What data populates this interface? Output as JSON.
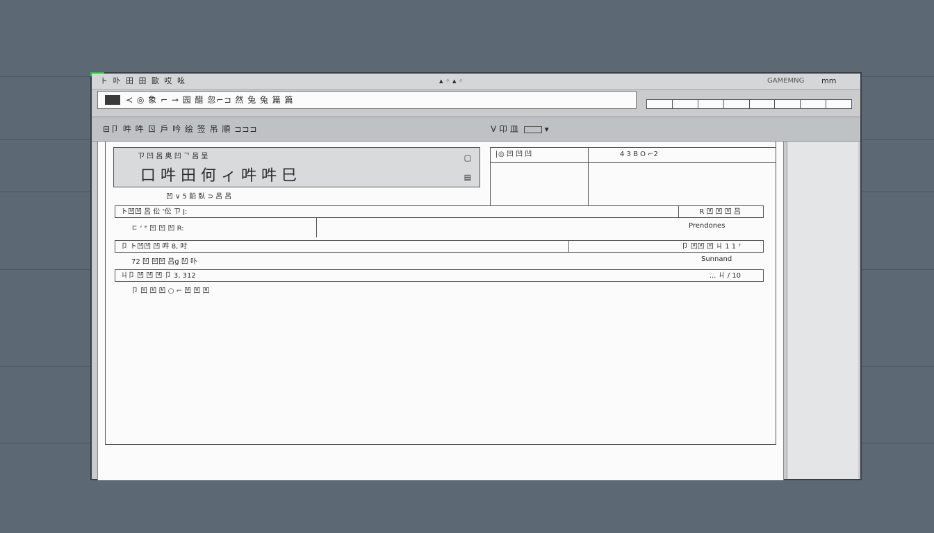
{
  "titlebar": {
    "menu_text": "ト 卟 田 田 歐 哎 吆",
    "center_text": "▴ ◦ ▴ ◦",
    "right_text": "GAMEMNG",
    "window_controls": "mm"
  },
  "address_bar": {
    "text": "≺ ◎ 象 ⌐ ⊸ 园 醋 忽⌐⊐ 然 兔 兔 篇 篇"
  },
  "toolbar": {
    "breadcrumb": "⊟卩 吽 吽 ㄖ 戶 吟 绘 签 吊 順 ⊐⊐⊐",
    "tools": "V 卬 皿"
  },
  "document": {
    "header_small": "ㄗ 凹 呂 奥 凹 ᄀ 呂 呈",
    "header_title": "口 吽 田 何 ィ 吽 吽 巳",
    "header_icons": [
      "▢",
      "▤"
    ],
    "subheader": "凹 ∨ 5 鉛 臥 ⊃ 呂 呂",
    "info_header_left": "∣◎ 凹 凹 凹",
    "info_header_right": "4 3 B O ⌐2",
    "rows": [
      {
        "left": "ト凹凹 呂 伀 ‘伀 ㄗ ǀ:",
        "right": "R 凹 凹 凹 吕"
      },
      {
        "left": "ㄷ ‘ ᵉ 凹 凹 凹 R:",
        "right": "Prendones"
      },
      {
        "left": "卩 ト凹凹 凹 吽 8, 吋",
        "right": "卩 凹凹 凹 ㄐ 1 1 ˀ"
      },
      {
        "left": "72  凹 凹凹 吕g 凹 卟",
        "right": "Sunnand"
      },
      {
        "left": "ㄐ卩 凹 凹 凹 卩 3‚ 312",
        "right": "... ㄐ / 10"
      },
      {
        "left": "卩 凹 凹 凹 ○ ⌐ 凹 凹 凹",
        "right": ""
      }
    ]
  }
}
